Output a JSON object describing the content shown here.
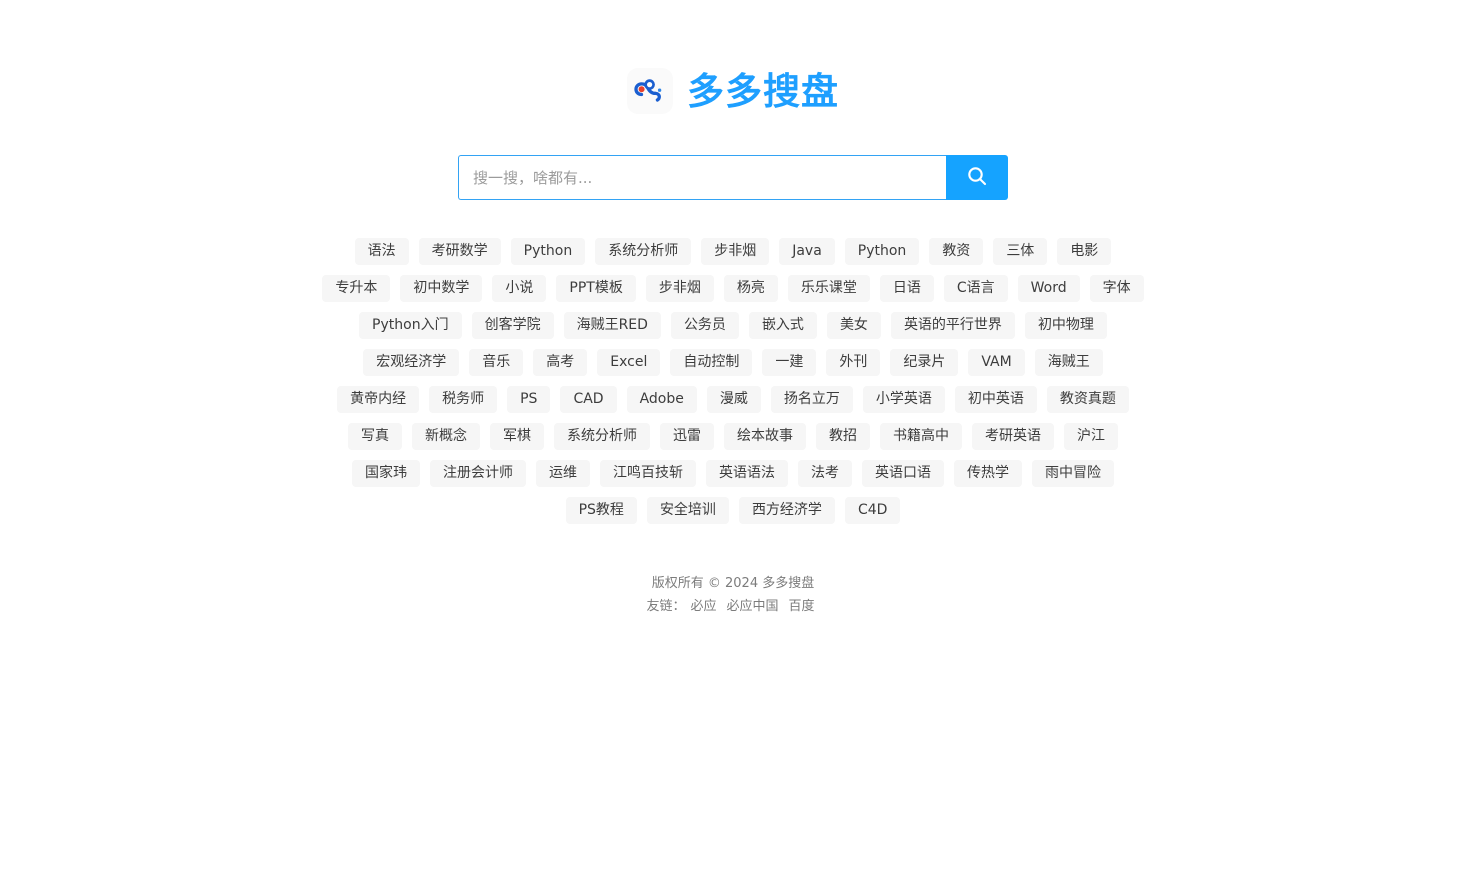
{
  "site": {
    "logo_text": "多多搜盘",
    "logo_icon": "duoduo-logo-icon",
    "accent_color": "#15a3ff",
    "logo_color": "#1e9fff",
    "tag_bg_color": "#f6f6f6"
  },
  "search": {
    "placeholder": "搜一搜，啥都有...",
    "value": "",
    "button_icon": "search-icon"
  },
  "tags": [
    "语法",
    "考研数学",
    "Python",
    "系统分析师",
    "步非烟",
    "Java",
    "Python",
    "教资",
    "三体",
    "电影",
    "专升本",
    "初中数学",
    "小说",
    "PPT模板",
    "步非烟",
    "杨亮",
    "乐乐课堂",
    "日语",
    "C语言",
    "Word",
    "字体",
    "Python入门",
    "创客学院",
    "海贼王RED",
    "公务员",
    "嵌入式",
    "美女",
    "英语的平行世界",
    "初中物理",
    "宏观经济学",
    "音乐",
    "高考",
    "Excel",
    "自动控制",
    "一建",
    "外刊",
    "纪录片",
    "VAM",
    "海贼王",
    "黄帝内经",
    "税务师",
    "PS",
    "CAD",
    "Adobe",
    "漫威",
    "扬名立万",
    "小学英语",
    "初中英语",
    "教资真题",
    "写真",
    "新概念",
    "军棋",
    "系统分析师",
    "迅雷",
    "绘本故事",
    "教招",
    "书籍高中",
    "考研英语",
    "沪江",
    "国家玮",
    "注册会计师",
    "运维",
    "江鸣百技斩",
    "英语语法",
    "法考",
    "英语口语",
    "传热学",
    "雨中冒险",
    "PS教程",
    "安全培训",
    "西方经济学",
    "C4D"
  ],
  "footer": {
    "copyright": "版权所有 © 2024 多多搜盘",
    "links_label": "友链：",
    "links": [
      "必应",
      "必应中国",
      "百度"
    ]
  }
}
